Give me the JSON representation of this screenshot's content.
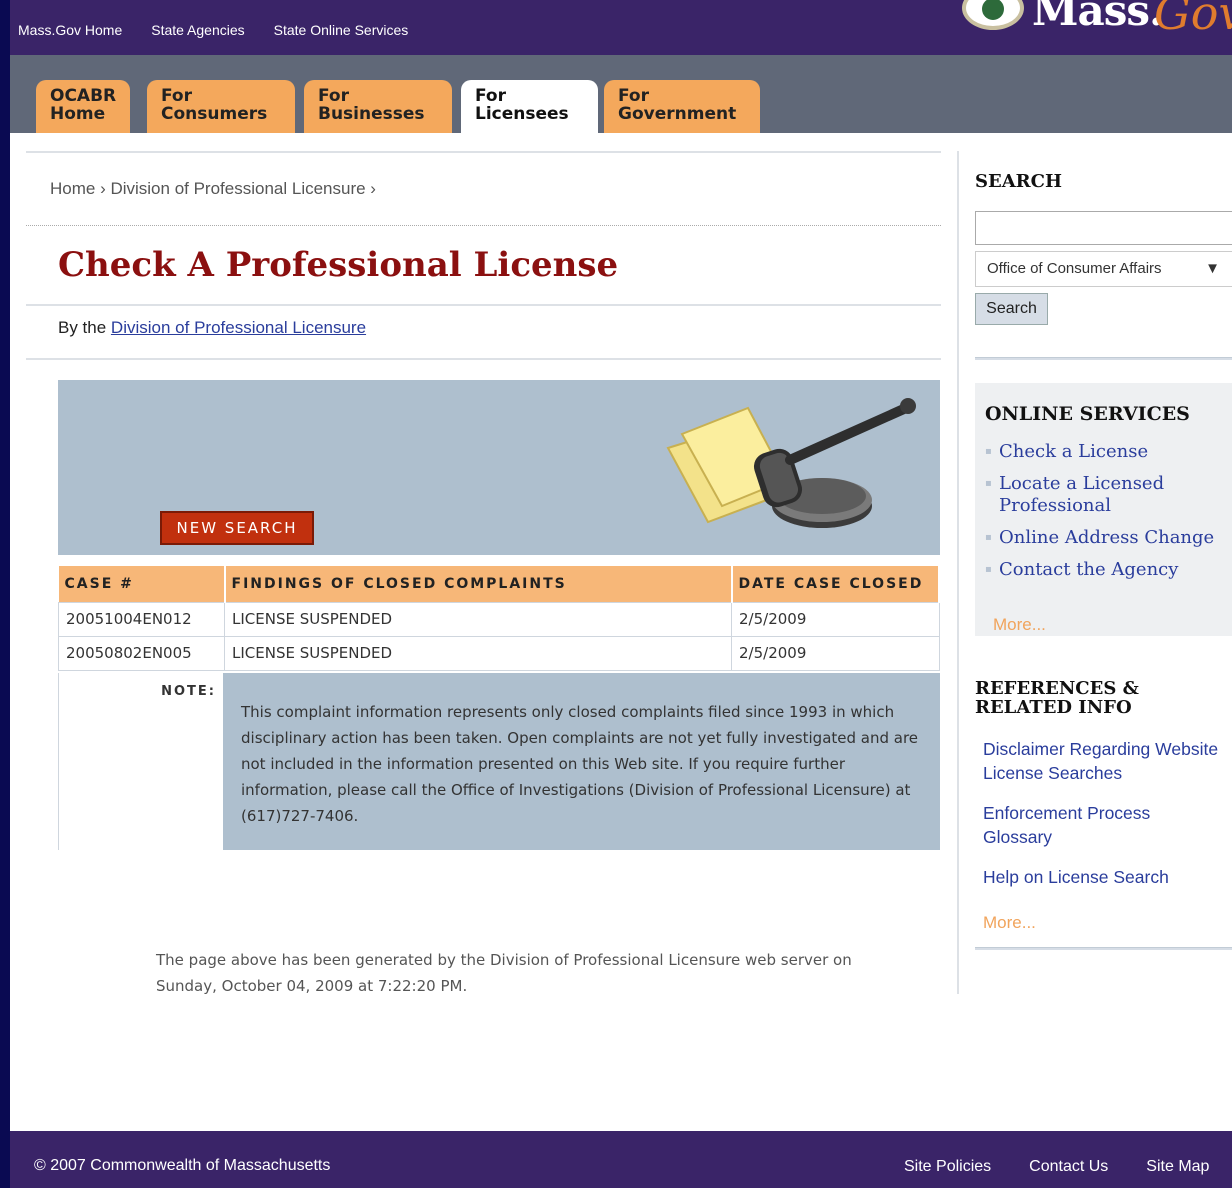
{
  "topbar": {
    "links": [
      "Mass.Gov Home",
      "State Agencies",
      "State Online Services"
    ],
    "logo_word": "Mass.",
    "logo_gov": "Gov"
  },
  "tabs": [
    {
      "line1": "OCABR",
      "line2": "Home"
    },
    {
      "line1": "For",
      "line2": "Consumers"
    },
    {
      "line1": "For",
      "line2": "Businesses"
    },
    {
      "line1": "For",
      "line2": "Licensees",
      "active": true
    },
    {
      "line1": "For",
      "line2": "Government"
    }
  ],
  "main": {
    "breadcrumb": "Home › Division of Professional Licensure ›",
    "title": "Check A Professional License",
    "byline_prefix": "By the ",
    "byline_link": "Division of Professional Licensure",
    "new_search_label": "NEW SEARCH",
    "table": {
      "headers": [
        "CASE #",
        "FINDINGS OF CLOSED COMPLAINTS",
        "DATE CASE CLOSED"
      ],
      "rows": [
        [
          "20051004EN012",
          "LICENSE SUSPENDED",
          "2/5/2009"
        ],
        [
          "20050802EN005",
          "LICENSE SUSPENDED",
          "2/5/2009"
        ]
      ]
    },
    "note_label": "NOTE:",
    "note_text": "This complaint information represents only closed complaints filed since 1993 in which disciplinary action has been taken. Open complaints are not yet fully investigated and are not included in the information presented on this Web site. If you require further information, please call the Office of Investigations (Division of Professional Licensure) at (617)727-7406.",
    "generated_text": "The page above has been generated by the Division of Professional Licensure web server on Sunday, October 04, 2009 at 7:22:20 PM."
  },
  "sidebar": {
    "search_heading": "SEARCH",
    "search_input_value": "",
    "scope_selected": "Office of Consumer Affairs",
    "search_button": "Search",
    "online_heading": "ONLINE SERVICES",
    "online_items": [
      "Check a License",
      "Locate a Licensed Professional",
      "Online Address Change",
      "Contact the Agency"
    ],
    "online_more": "More...",
    "refs_heading": "REFERENCES & RELATED INFO",
    "refs_links": [
      "Disclaimer Regarding Website License Searches",
      "Enforcement Process Glossary",
      "Help on License Search"
    ],
    "refs_more": "More..."
  },
  "footer": {
    "copyright": "© 2007 Commonwealth of Massachusetts",
    "links": [
      "Site Policies",
      "Contact Us",
      "Site Map"
    ]
  },
  "colors": {
    "brand_purple": "#3a2468",
    "tab_orange": "#f4a85c",
    "title_red": "#8b1010",
    "panel_blue": "#aebfce"
  }
}
